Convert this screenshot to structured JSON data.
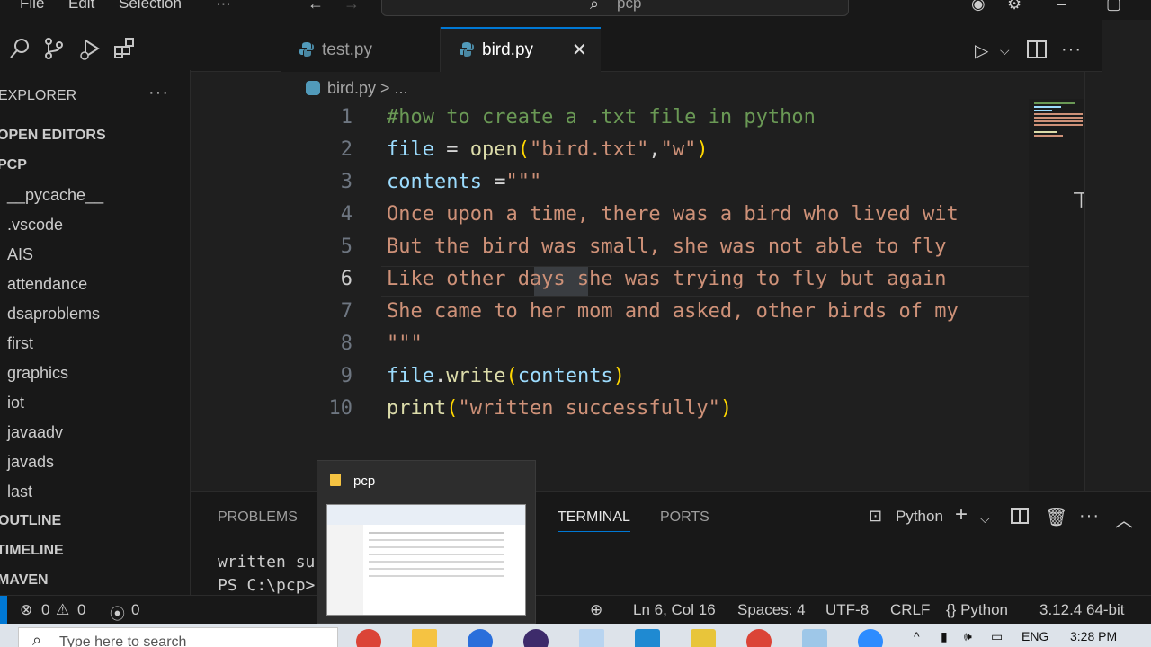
{
  "menu": [
    "File",
    "Edit",
    "Selection",
    "···"
  ],
  "search": {
    "text": "pcp"
  },
  "explorer": {
    "title": "EXPLORER",
    "more": "···",
    "open_editors": "OPEN EDITORS",
    "root": "PCP",
    "folders": [
      "__pycache__",
      ".vscode",
      "AIS",
      "attendance",
      "dsaproblems",
      "first",
      "graphics",
      "iot",
      "javaadv",
      "javads",
      "last"
    ],
    "outline": "OUTLINE",
    "timeline": "TIMELINE",
    "maven": "MAVEN"
  },
  "tabs": [
    {
      "label": "test.py",
      "active": false
    },
    {
      "label": "bird.py",
      "active": true
    }
  ],
  "tab_close": "✕",
  "breadcrumb": "bird.py  >  ...",
  "editor": {
    "line_numbers": [
      "1",
      "2",
      "3",
      "4",
      "5",
      "6",
      "7",
      "8",
      "9",
      "10"
    ],
    "active_line": 6,
    "highlighted_word": "days",
    "lines": [
      [
        {
          "t": "#how to create a .txt file in python",
          "c": "comment"
        }
      ],
      [
        {
          "t": "file",
          "c": "var"
        },
        {
          "t": " = ",
          "c": "plain"
        },
        {
          "t": "open",
          "c": "fn"
        },
        {
          "t": "(",
          "c": "paren"
        },
        {
          "t": "\"bird.txt\"",
          "c": "str"
        },
        {
          "t": ",",
          "c": "plain"
        },
        {
          "t": "\"w\"",
          "c": "str"
        },
        {
          "t": ")",
          "c": "paren"
        }
      ],
      [
        {
          "t": "contents",
          "c": "var"
        },
        {
          "t": " =",
          "c": "plain"
        },
        {
          "t": "\"\"\"",
          "c": "str"
        }
      ],
      [
        {
          "t": "Once upon a time, there was a bird who lived wit",
          "c": "str"
        }
      ],
      [
        {
          "t": "But the bird was small, she was not able to fly ",
          "c": "str"
        }
      ],
      [
        {
          "t": "Like other days she was trying to fly but again ",
          "c": "str"
        }
      ],
      [
        {
          "t": "She came to her mom and asked, other birds of my",
          "c": "str"
        }
      ],
      [
        {
          "t": "\"\"\"",
          "c": "str"
        }
      ],
      [
        {
          "t": "file",
          "c": "var"
        },
        {
          "t": ".",
          "c": "plain"
        },
        {
          "t": "write",
          "c": "fn"
        },
        {
          "t": "(",
          "c": "paren"
        },
        {
          "t": "contents",
          "c": "var"
        },
        {
          "t": ")",
          "c": "paren"
        }
      ],
      [
        {
          "t": "print",
          "c": "fn"
        },
        {
          "t": "(",
          "c": "paren"
        },
        {
          "t": "\"written successfully\"",
          "c": "str"
        },
        {
          "t": ")",
          "c": "paren"
        }
      ]
    ]
  },
  "panel": {
    "tabs": [
      "PROBLEMS",
      "TERMINAL",
      "PORTS"
    ],
    "active_tab": "TERMINAL",
    "terminal_profile": "Python",
    "terminal_lines": [
      "written su",
      "PS C:\\pcp>"
    ]
  },
  "preview": {
    "title": "pcp"
  },
  "status": {
    "errors": "0",
    "warnings": "0",
    "ports": "0",
    "cursor": "Ln 6, Col 16",
    "spaces": "Spaces: 4",
    "encoding": "UTF-8",
    "eol": "CRLF",
    "language": "{} Python",
    "interpreter": "3.12.4 64-bit"
  },
  "taskbar": {
    "search_placeholder": "Type here to search",
    "lang": "ENG",
    "time": "3:28 PM"
  },
  "colors": {
    "accent": "#0078d4",
    "comment": "#6a9955",
    "string": "#ce9178",
    "variable": "#9cdcfe",
    "function": "#dcdcaa"
  }
}
